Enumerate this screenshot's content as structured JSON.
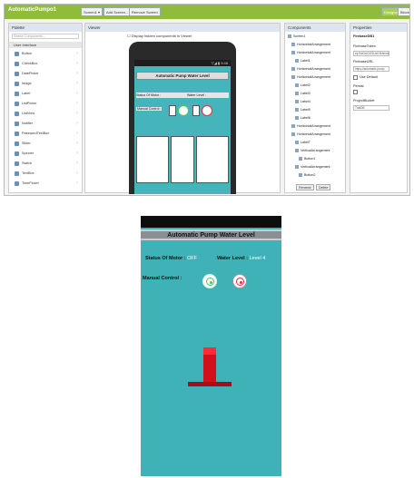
{
  "designer": {
    "project_name": "AutomaticPumpo1",
    "toolbar": [
      "Screen1 ▾",
      "Add Screen...",
      "Remove Screen"
    ],
    "toolbar_right": [
      "Designer",
      "Blocks"
    ],
    "palette": {
      "title": "Palette",
      "search_placeholder": "Search Components...",
      "group": "User Interface",
      "items": [
        "Button",
        "CheckBox",
        "DatePicker",
        "Image",
        "Label",
        "ListPicker",
        "ListView",
        "Notifier",
        "PasswordTextBox",
        "Slider",
        "Spinner",
        "Switch",
        "TextBox",
        "TimePicker"
      ]
    },
    "viewer": {
      "title": "Viewer",
      "checkbox_label": "Display hidden components in Viewer",
      "phone_time": "▽◢ ▮ 9:48",
      "app_title": "Automatic Pump Water Level",
      "status_label": "Status Of Motor :",
      "level_label": "Water Level :",
      "manual_label": "Manual Control :"
    },
    "components": {
      "title": "Components",
      "items": [
        "Screen1",
        "HorizontalArrangement",
        "HorizontalArrangement",
        "Label1",
        "HorizontalArrangement",
        "HorizontalArrangement",
        "Label2",
        "Label3",
        "Label4",
        "Label5",
        "Label6",
        "HorizontalArrangement",
        "HorizontalArrangement",
        "Label7",
        "VerticalArrangement",
        "Button1",
        "VerticalArrangement",
        "Button2"
      ],
      "rename_label": "Rename",
      "delete_label": "Delete"
    },
    "properties": {
      "title": "Properties",
      "component": "FirebaseDB1",
      "fields": [
        {
          "label": "FirebaseToken",
          "value": "eyJhbGciOiJSUzI1NiIsImtp"
        },
        {
          "label": "FirebaseURL",
          "value": "https://automatic-pump"
        },
        {
          "label": "Use Default",
          "value": ""
        },
        {
          "label": "Persist",
          "value": ""
        },
        {
          "label": "ProjectBucket",
          "value": "TrialDB"
        }
      ]
    }
  },
  "app": {
    "title": "Automatic Pump Water Level",
    "status_label": "Status Of Motor :",
    "status_value": "OFF",
    "level_label": "Water Level :",
    "level_value": "Level 4",
    "manual_label": "Manual Control :"
  },
  "colors": {
    "brand_green": "#8fbc3a",
    "app_bg": "#3fb2b8",
    "on_button": "#3fd05a",
    "off_button": "#e0303a",
    "tank": "#d0101a"
  }
}
